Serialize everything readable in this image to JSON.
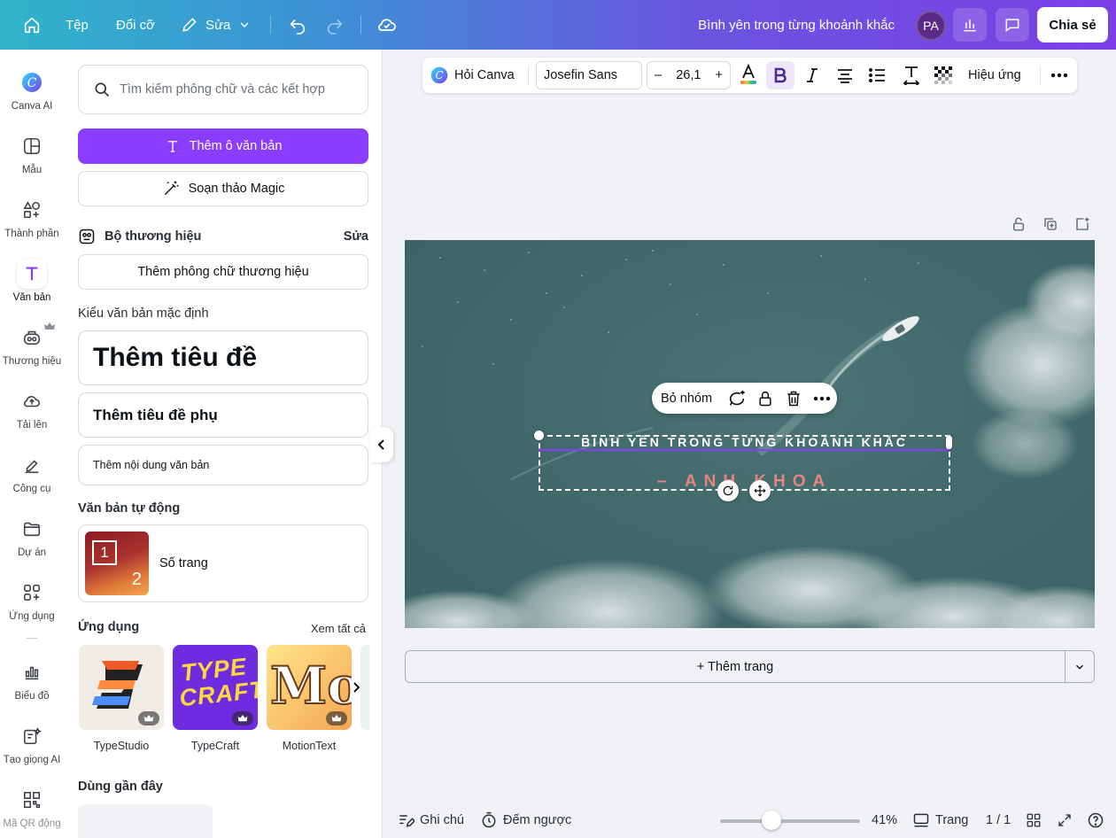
{
  "topbar": {
    "file": "Tệp",
    "resize": "Đổi cỡ",
    "edit": "Sửa",
    "doc_title": "Bình yên trong từng khoảnh khắc",
    "avatar": "PA",
    "share": "Chia sẻ"
  },
  "rail": [
    {
      "label": "Canva AI",
      "icon": "canva-ai-icon"
    },
    {
      "label": "Mẫu",
      "icon": "templates-icon"
    },
    {
      "label": "Thành phần",
      "icon": "elements-icon"
    },
    {
      "label": "Văn bản",
      "icon": "text-icon"
    },
    {
      "label": "Thương hiệu",
      "icon": "brand-icon"
    },
    {
      "label": "Tải lên",
      "icon": "upload-icon"
    },
    {
      "label": "Công cụ",
      "icon": "tools-icon"
    },
    {
      "label": "Dự án",
      "icon": "folder-icon"
    },
    {
      "label": "Ứng dụng",
      "icon": "apps-icon"
    },
    {
      "label": "Biểu đồ",
      "icon": "chart-icon"
    },
    {
      "label": "Tạo giọng AI",
      "icon": "ai-voice-icon"
    },
    {
      "label": "Mã QR động",
      "icon": "qr-icon"
    }
  ],
  "panel": {
    "search_placeholder": "Tìm kiếm phông chữ và các kết hợp",
    "add_textbox": "Thêm ô văn bản",
    "magic_write": "Soạn thảo Magic",
    "brand_kit": "Bộ thương hiệu",
    "brand_edit": "Sửa",
    "add_brand_font": "Thêm phông chữ thương hiệu",
    "default_styles": "Kiểu văn bản mặc định",
    "heading": "Thêm tiêu đề",
    "subheading": "Thêm tiêu đề phụ",
    "body": "Thêm nội dung văn bản",
    "auto_text": "Văn bản tự động",
    "page_number": "Số trang",
    "page_number_thumb": [
      "1",
      "2"
    ],
    "apps": "Ứng dụng",
    "see_all": "Xem tất cả",
    "app_list": [
      {
        "name": "TypeStudio"
      },
      {
        "name": "TypeCraft",
        "art": "TYPE CRAFT"
      },
      {
        "name": "MotionText",
        "art": "Mo"
      }
    ],
    "recent": "Dùng gần đây"
  },
  "toolbar": {
    "ask_canva": "Hỏi Canva",
    "font": "Josefin Sans",
    "font_size": "26,1",
    "minus": "–",
    "plus": "+",
    "effects": "Hiệu ứng"
  },
  "canvas": {
    "context_menu": {
      "ungroup": "Bỏ nhóm"
    },
    "title_text": "BÌNH YÊN TRONG TỪNG KHOẢNH KHẮC",
    "subtitle_text": "– ANH KHOA",
    "add_page": "+ Thêm trang"
  },
  "bottombar": {
    "notes": "Ghi chú",
    "timer": "Đếm ngược",
    "zoom": "41%",
    "pages": "Trang",
    "page_count": "1 / 1"
  },
  "colors": {
    "accent": "#8b3dff",
    "subtitle": "#e58582",
    "sea": "#426a6b"
  }
}
